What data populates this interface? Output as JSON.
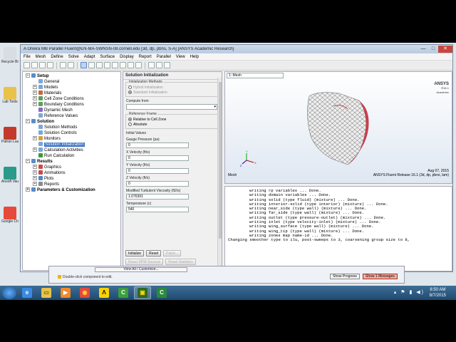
{
  "window": {
    "title": "A Oneira MB Parallel Fluent@EN-MA-SWNSN-08.cornell.edu  [3d, dp, pbns, S-A] [ANSYS Academic Research]",
    "controls": [
      "—",
      "□",
      "✕"
    ]
  },
  "menu": [
    "File",
    "Mesh",
    "Define",
    "Solve",
    "Adapt",
    "Surface",
    "Display",
    "Report",
    "Parallel",
    "View",
    "Help"
  ],
  "desktop_icons": [
    {
      "label": "Recycle Bin",
      "icon": "recycle-bin-icon",
      "color": "#d8dde4"
    },
    {
      "label": "Lab Tools",
      "icon": "folder-icon",
      "color": "#e8c24a"
    },
    {
      "label": "Patran Launcher",
      "icon": "patran-icon",
      "color": "#c43a2a"
    },
    {
      "label": "Ansoft Vault 2",
      "icon": "ansoft-icon",
      "color": "#2a9a8a"
    },
    {
      "label": "Google Chrome",
      "icon": "chrome-icon",
      "color": "#e54a3a"
    }
  ],
  "tree": [
    {
      "label": "Setup",
      "level": 0,
      "exp": "−",
      "icon_color": "#5a8cc8"
    },
    {
      "label": "General",
      "level": 1,
      "icon_color": "#7aa7d8"
    },
    {
      "label": "Models",
      "level": 1,
      "exp": "+",
      "icon_color": "#7aa7d8"
    },
    {
      "label": "Materials",
      "level": 1,
      "exp": "+",
      "icon_color": "#c46a3a"
    },
    {
      "label": "Cell Zone Conditions",
      "level": 1,
      "exp": "+",
      "icon_color": "#5aa05a"
    },
    {
      "label": "Boundary Conditions",
      "level": 1,
      "exp": "+",
      "icon_color": "#5aa05a"
    },
    {
      "label": "Dynamic Mesh",
      "level": 1,
      "icon_color": "#8a6ac8"
    },
    {
      "label": "Reference Values",
      "level": 1,
      "icon_color": "#7aa7d8"
    },
    {
      "label": "Solution",
      "level": 0,
      "exp": "−",
      "icon_color": "#5a8cc8"
    },
    {
      "label": "Solution Methods",
      "level": 1,
      "icon_color": "#7aa7d8"
    },
    {
      "label": "Solution Controls",
      "level": 1,
      "icon_color": "#7aa7d8"
    },
    {
      "label": "Monitors",
      "level": 1,
      "exp": "+",
      "icon_color": "#d8a03a"
    },
    {
      "label": "Solution Initialization",
      "level": 1,
      "selected": true,
      "icon_color": "#7aa7d8"
    },
    {
      "label": "Calculation Activities",
      "level": 1,
      "exp": "+",
      "icon_color": "#7aa7d8"
    },
    {
      "label": "Run Calculation",
      "level": 1,
      "icon_color": "#3a9a3a"
    },
    {
      "label": "Results",
      "level": 0,
      "exp": "−",
      "icon_color": "#5a8cc8"
    },
    {
      "label": "Graphics",
      "level": 1,
      "exp": "+",
      "icon_color": "#c84a4a"
    },
    {
      "label": "Animations",
      "level": 1,
      "exp": "+",
      "icon_color": "#c84a4a"
    },
    {
      "label": "Plots",
      "level": 1,
      "exp": "+",
      "icon_color": "#4a8ac8"
    },
    {
      "label": "Reports",
      "level": 1,
      "exp": "+",
      "icon_color": "#8a8a8a"
    },
    {
      "label": "Parameters & Customization",
      "level": 0,
      "exp": "+",
      "icon_color": "#5a8cc8"
    }
  ],
  "task": {
    "title": "Solution Initialization",
    "methods_label": "Initialization Methods",
    "method_hybrid": "Hybrid Initialization",
    "method_standard": "Standard Initialization",
    "compute_from": "Compute from",
    "compute_value": "",
    "ref_frame_label": "Reference Frame",
    "ref_relative": "Relative to Cell Zone",
    "ref_absolute": "Absolute",
    "initial_values": "Initial Values",
    "fields": [
      {
        "label": "Gauge Pressure (pa)",
        "value": "0"
      },
      {
        "label": "X Velocity (ft/s)",
        "value": "0"
      },
      {
        "label": "Y Velocity (ft/s)",
        "value": "0"
      },
      {
        "label": "Z Velocity (ft/s)",
        "value": "0"
      },
      {
        "label": "Modified Turbulent Viscosity (ft2/s)",
        "value": "1.076391"
      },
      {
        "label": "Temperature (c)",
        "value": "540"
      }
    ],
    "btn_initialize": "Initialize",
    "btn_reset": "Reset",
    "btn_patch": "Patch...",
    "btn_reset_dpm": "Reset DPM Sources",
    "btn_reset_stats": "Reset Statistics"
  },
  "graphics": {
    "window_select": "1: Mesh",
    "brand": "ANSYS",
    "brand_sub": "R16.1",
    "brand_sub2": "Academic",
    "mesh_label": "Mesh",
    "date": "Aug 07, 2015",
    "release": "ANSYS Fluent Release 16.1 (3d, dp, pbns, lam)"
  },
  "console": [
    "writing rp variables ... Done.",
    "writing domain variables ... Done.",
    "writing solid (type fluid) (mixture) ... Done.",
    "writing interior-solid (type interior) (mixture) ... Done.",
    "writing near_side (type wall) (mixture) ... Done.",
    "writing far_side (type wall) (mixture) ... Done.",
    "writing outlet (type pressure-outlet) (mixture) ... Done.",
    "writing inlet (type velocity-inlet) (mixture) ... Done.",
    "writing wing_surface (type wall) (mixture) ... Done.",
    "writing wing_tip (type wall) (mixture) ... Done.",
    "writing zones map name-id ... Done."
  ],
  "console_last": "Changing smoother type to ilu, post-sweeps to 3, coarsening group size to 8,",
  "statusbar": {
    "view_all": "View All / Customize...",
    "hint": "Double-click component to edit.",
    "show_progress": "Show Progress",
    "show_messages": "Show 1 Messages"
  },
  "taskbar": {
    "apps": [
      {
        "name": "ie-icon",
        "glyph": "e",
        "color": "#3a8ae0",
        "fg": "#fff"
      },
      {
        "name": "explorer-icon",
        "glyph": "▭",
        "color": "#e8c24a",
        "fg": "#7a5a10"
      },
      {
        "name": "media-player-icon",
        "glyph": "▶",
        "color": "#f08a2a",
        "fg": "#fff"
      },
      {
        "name": "chrome-icon",
        "glyph": "◉",
        "color": "#e54a3a",
        "fg": "#ffd23a"
      },
      {
        "name": "ansys-icon",
        "glyph": "Λ",
        "color": "#ffd200",
        "fg": "#000"
      },
      {
        "name": "fluent-launcher-icon",
        "glyph": "C",
        "color": "#3aa03a",
        "fg": "#fff"
      },
      {
        "name": "fluent-active-icon",
        "glyph": "▣",
        "color": "#2a6a2a",
        "fg": "#ffd200"
      },
      {
        "name": "ansys-cfd-icon",
        "glyph": "C",
        "color": "#2a8a3a",
        "fg": "#fff"
      }
    ],
    "time": "8:50 AM",
    "date": "8/7/2015",
    "tray": "▴ ⚑ ▮ ◀)"
  }
}
